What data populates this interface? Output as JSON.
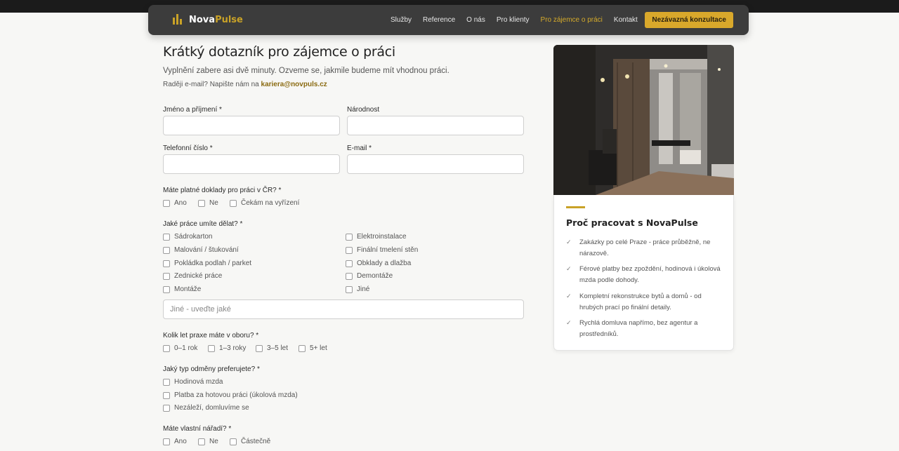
{
  "nav": {
    "brand_part1": "Nova",
    "brand_part2": "Pulse",
    "links": [
      "Služby",
      "Reference",
      "O nás",
      "Pro klienty",
      "Pro zájemce o práci",
      "Kontakt"
    ],
    "active_link": "Pro zájemce o práci",
    "cta": "Nezávazná konzultace"
  },
  "header": {
    "title": "Krátký dotazník pro zájemce o práci",
    "subtitle": "Vyplnění zabere asi dvě minuty. Ozveme se, jakmile budeme mít vhodnou práci.",
    "email_prefix": "Raději e-mail? Napište nám na",
    "email": "kariera@novpuls.cz"
  },
  "form": {
    "name_label": "Jméno a příjmení *",
    "nationality_label": "Národnost",
    "phone_label": "Telefonní číslo *",
    "email_label": "E-mail *",
    "documents": {
      "label": "Máte platné doklady pro práci v ČR? *",
      "options": [
        "Ano",
        "Ne",
        "Čekám na vyřízení"
      ]
    },
    "skills": {
      "label": "Jaké práce umíte dělat? *",
      "left": [
        "Sádrokarton",
        "Malování / štukování",
        "Pokládka podlah / parket",
        "Zednické práce",
        "Montáže"
      ],
      "right": [
        "Elektroinstalace",
        "Finální tmelení stěn",
        "Obklady a dlažba",
        "Demontáže",
        "Jiné"
      ],
      "other_placeholder": "Jiné - uveďte jaké"
    },
    "experience": {
      "label": "Kolik let praxe máte v oboru? *",
      "options": [
        "0–1 rok",
        "1–3 roky",
        "3–5 let",
        "5+ let"
      ]
    },
    "pay": {
      "label": "Jaký typ odměny preferujete? *",
      "options": [
        "Hodinová mzda",
        "Platba za hotovou práci (úkolová mzda)",
        "Nezáleží, domluvíme se"
      ]
    },
    "tools": {
      "label": "Máte vlastní nářadí? *",
      "options": [
        "Ano",
        "Ne",
        "Částečně"
      ]
    }
  },
  "sidebar": {
    "title": "Proč pracovat s NovaPulse",
    "benefits": [
      "Zakázky po celé Praze - práce průběžně, ne nárazově.",
      "Férové platby bez zpoždění, hodinová i úkolová mzda podle dohody.",
      "Kompletní rekonstrukce bytů a domů - od hrubých prací po finální detaily.",
      "Rychlá domluva napřímo, bez agentur a prostředníků."
    ]
  },
  "colors": {
    "accent": "#c9a227",
    "nav_bg": "#3c3c3c",
    "page_bg": "#f7f7f5"
  },
  "icons": [
    "logo-icon",
    "check-icon",
    "checkbox"
  ]
}
